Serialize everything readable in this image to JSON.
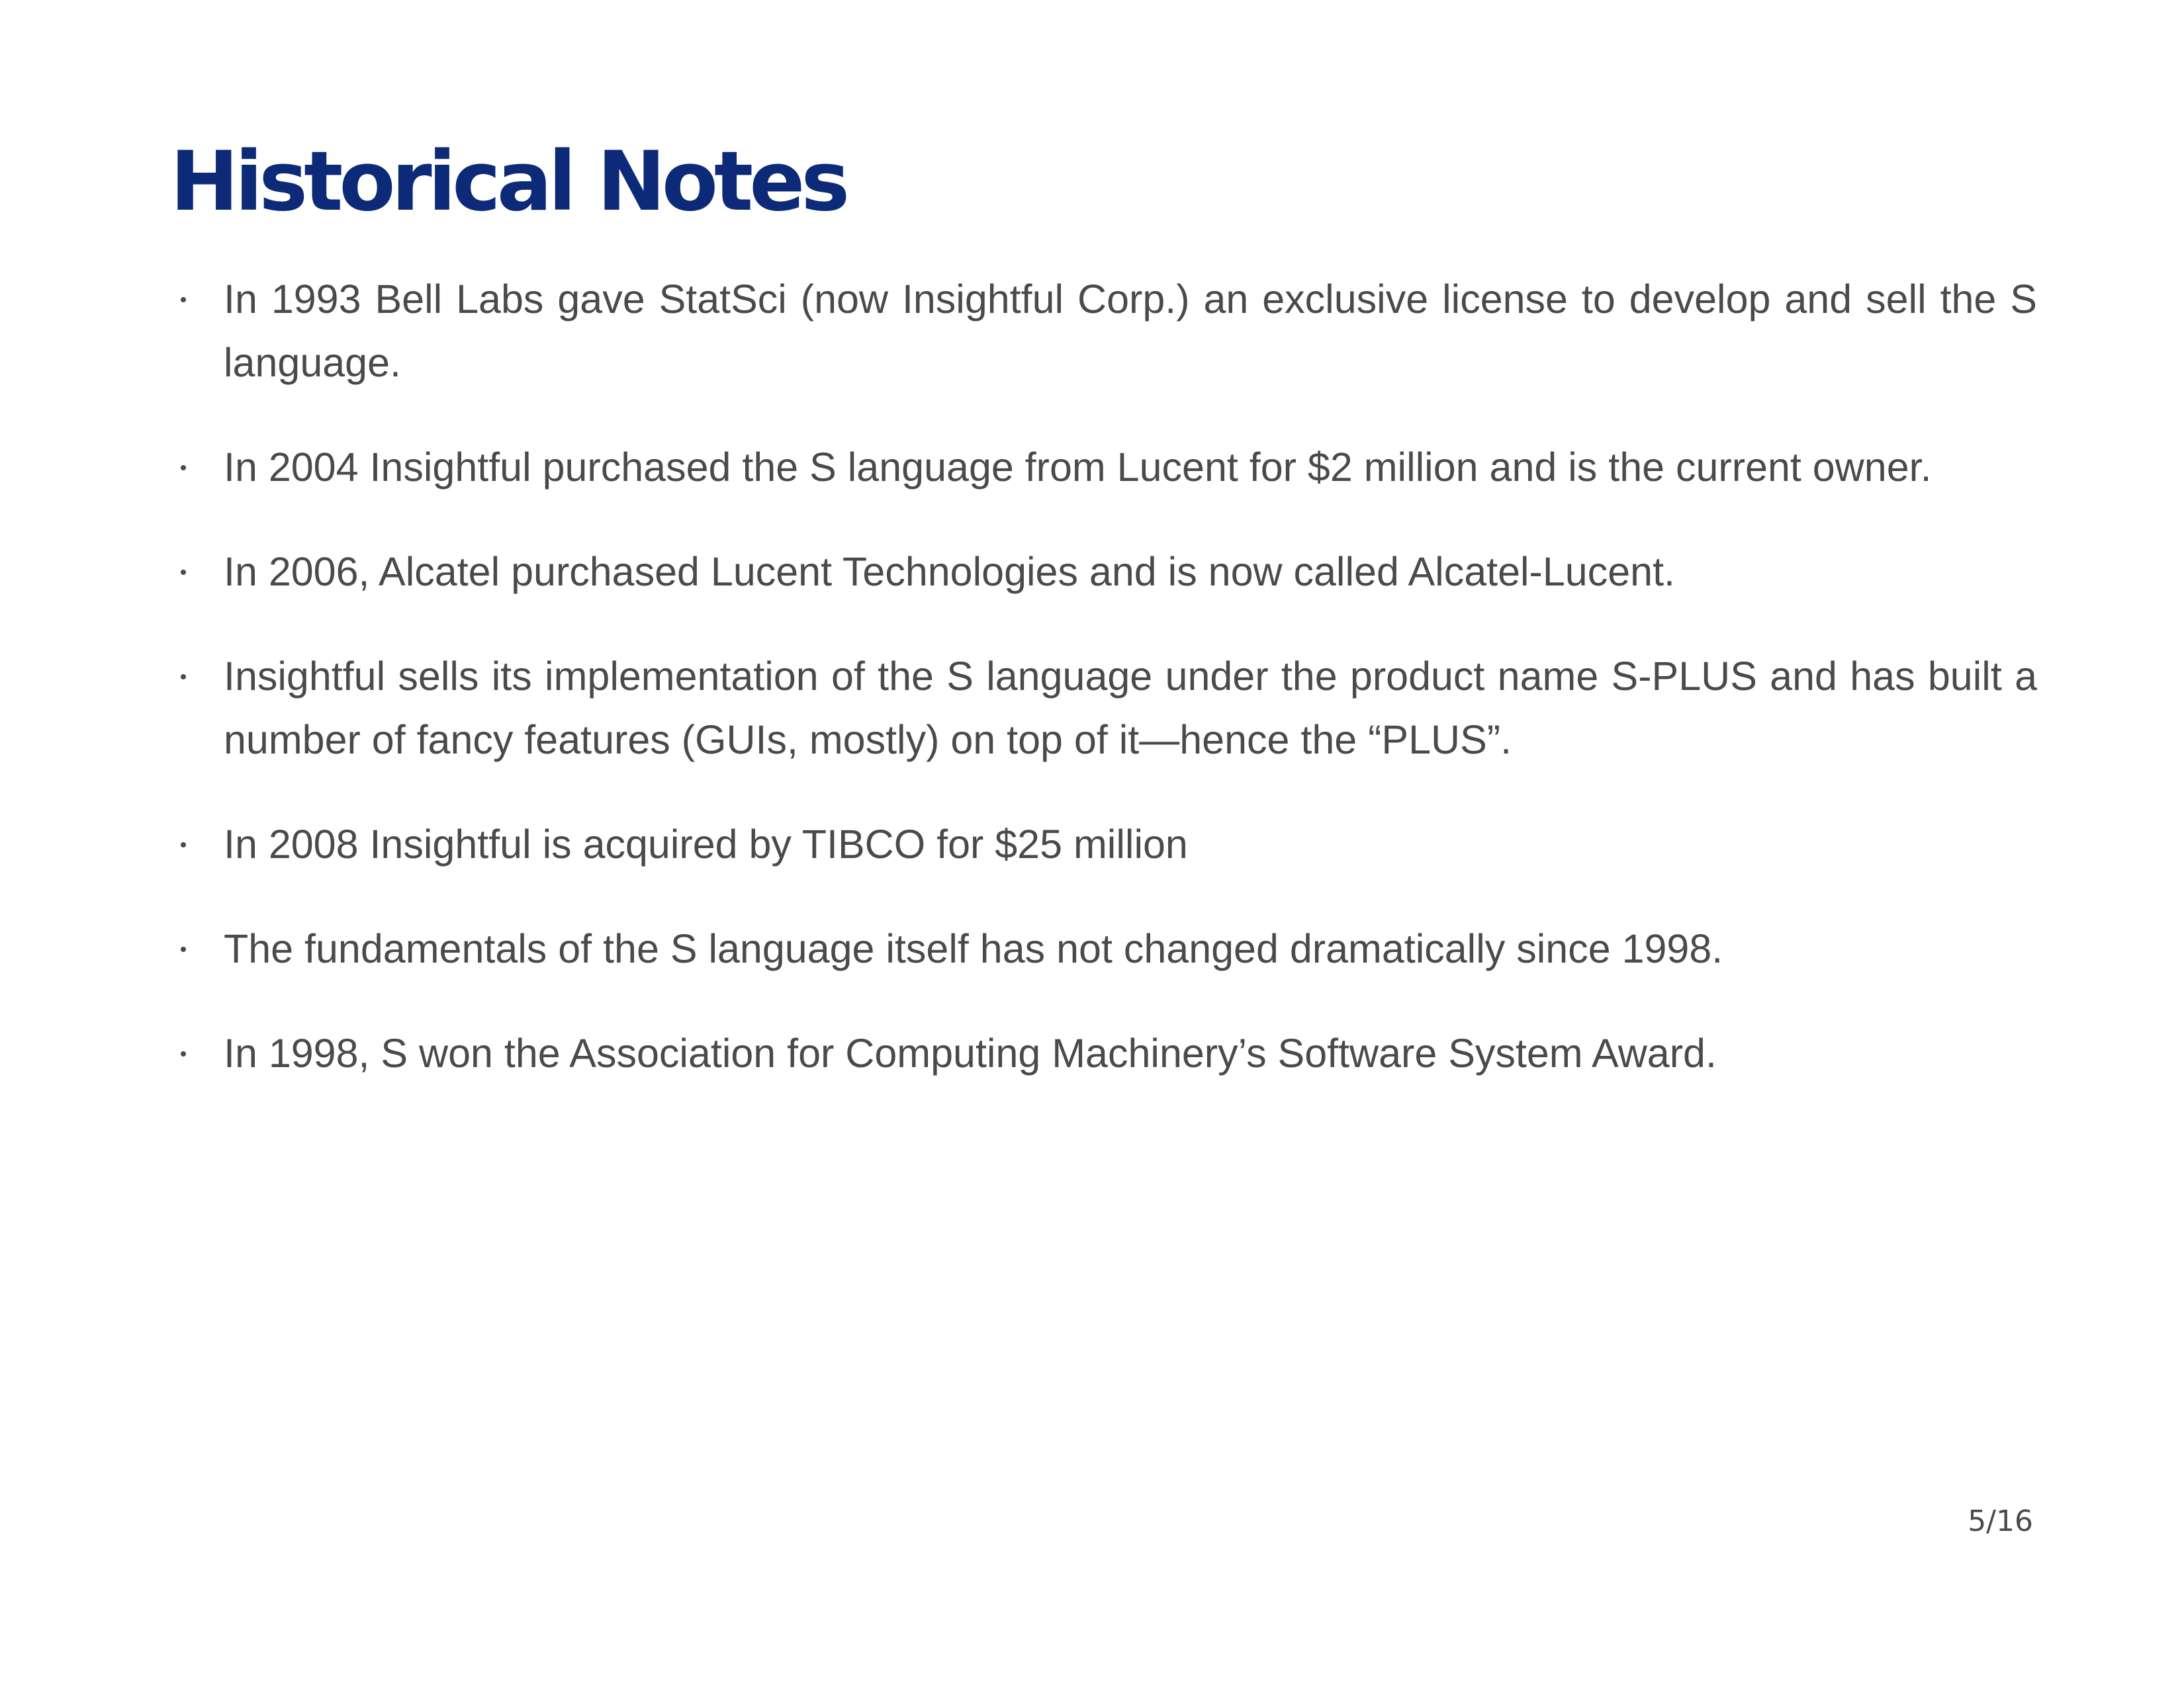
{
  "slide": {
    "title": "Historical Notes",
    "bullets": [
      "In 1993 Bell Labs gave StatSci (now Insightful Corp.) an exclusive license to develop and sell the S language.",
      "In 2004 Insightful purchased the S language from Lucent for $2 million and is the current owner.",
      "In 2006, Alcatel purchased Lucent Technologies and is now called Alcatel-Lucent.",
      "Insightful sells its implementation of the S language under the product name S-PLUS and has built a number of fancy features (GUIs, mostly) on top of it—hence the “PLUS”.",
      "In 2008 Insightful is acquired by TIBCO for $25 million",
      "The fundamentals of the S language itself has not changed dramatically since 1998.",
      "In 1998, S won the Association for Computing Machinery’s Software System Award."
    ],
    "page_number": "5/16"
  },
  "colors": {
    "title": "#0c2a78",
    "body_text": "#4a4a4a",
    "background": "#ffffff"
  }
}
